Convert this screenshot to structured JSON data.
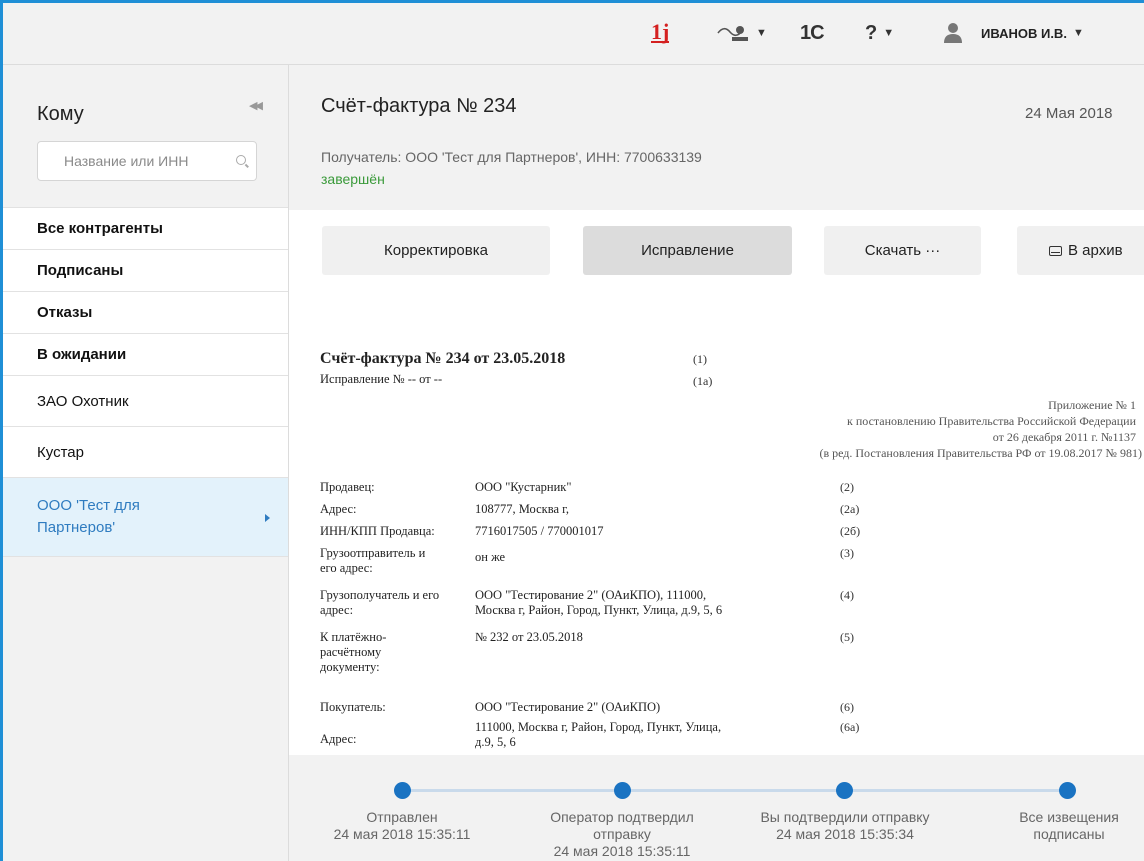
{
  "topbar": {
    "logo_text": "1j",
    "onec_label": "1С",
    "help_label": "?",
    "user_name": "ИВАНОВ И.В.",
    "icons": [
      "logo-1j-icon",
      "signature-icon",
      "onec-icon",
      "help-icon",
      "user-icon"
    ]
  },
  "sidebar": {
    "title": "Кому",
    "search_placeholder": "Название или ИНН",
    "items": [
      {
        "label": "Все контрагенты"
      },
      {
        "label": "Подписаны"
      },
      {
        "label": "Отказы"
      },
      {
        "label": "В ожидании"
      },
      {
        "label": "ЗАО Охотник"
      },
      {
        "label": "Кустар"
      },
      {
        "label_line1": "ООО 'Тест для",
        "label_line2": "Партнеров'"
      }
    ]
  },
  "document": {
    "title": "Счёт-фактура № 234",
    "date": "24 Мая 2018",
    "recipient": "Получатель: ООО 'Тест для Партнеров', ИНН: 7700633139",
    "status": "завершён"
  },
  "actions": {
    "correction": "Корректировка",
    "fix": "Исправление",
    "download": "Скачать ···",
    "archive": "В архив"
  },
  "invoice": {
    "title": "Счёт-фактура № 234 от 23.05.2018",
    "title_num": "(1)",
    "fix_line": "Исправление № -- от --",
    "fix_num": "(1а)",
    "appendix": [
      "Приложение № 1",
      "к постановлению Правительства Российской Федерации",
      "от 26 декабря 2011 г. №1137",
      "(в ред. Постановления Правительства РФ от 19.08.2017 № 981)"
    ],
    "fields": [
      {
        "label": "Продавец:",
        "value": "ООО \"Кустарник\"",
        "num": "(2)"
      },
      {
        "label": "Адрес:",
        "value": "108777, Москва г,",
        "num": "(2а)"
      },
      {
        "label": "ИНН/КПП Продавца:",
        "value": "7716017505 / 770001017",
        "num": "(2б)"
      },
      {
        "label_l1": "Грузоотправитель и",
        "label_l2": "его адрес:",
        "value": "он же",
        "num": "(3)"
      },
      {
        "label_l1": "Грузополучатель и его",
        "label_l2": "адрес:",
        "value_l1": "ООО \"Тестирование 2\" (ОАиКПО), 111000,",
        "value_l2": "Москва г, Район, Город, Пункт, Улица, д.9, 5, 6",
        "num": "(4)"
      },
      {
        "label_l1": "К платёжно-",
        "label_l2": "расчётному",
        "label_l3": "документу:",
        "value": "№ 232 от 23.05.2018",
        "num": "(5)"
      },
      {
        "label": "Покупатель:",
        "value": "ООО \"Тестирование 2\" (ОАиКПО)",
        "num": "(6)"
      },
      {
        "label": "Адрес:",
        "value_l1": "111000, Москва г, Район, Город, Пункт, Улица,",
        "value_l2": "д.9, 5, 6",
        "num": "(6а)"
      }
    ]
  },
  "timeline": [
    {
      "title": "Отправлен",
      "time": "24 мая 2018 15:35:11"
    },
    {
      "title_l1": "Оператор подтвердил",
      "title_l2": "отправку",
      "time": "24 мая 2018 15:35:11"
    },
    {
      "title": "Вы подтвердили отправку",
      "time": "24 мая 2018 15:35:34"
    },
    {
      "title_l1": "Все извещения",
      "title_l2": "подписаны"
    }
  ],
  "colors": {
    "accent": "#1a73c2",
    "status_green": "#3a9a3a",
    "active_bg": "#e3f2fb"
  }
}
